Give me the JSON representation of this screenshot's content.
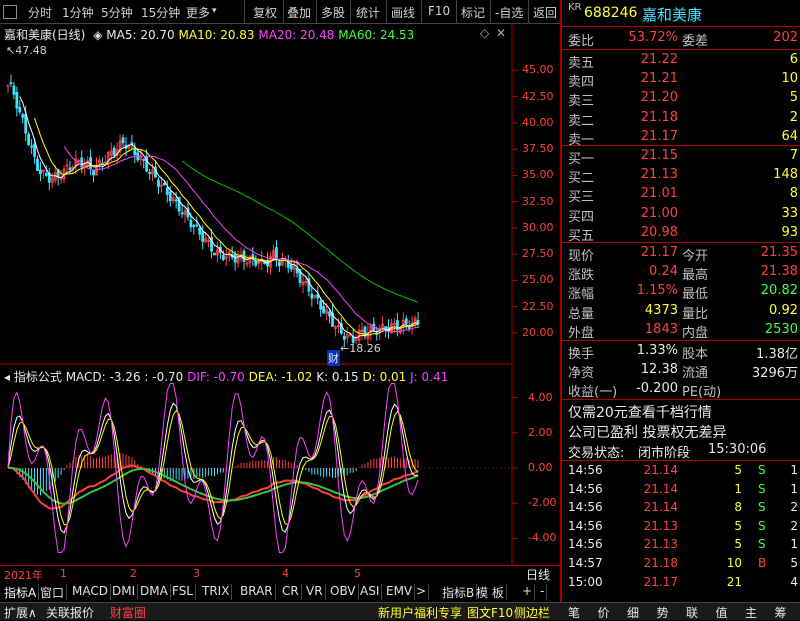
{
  "toolbar": {
    "items": [
      "分时",
      "1分钟",
      "5分钟",
      "15分钟",
      "更多",
      "复权",
      "叠加",
      "多股",
      "统计",
      "画线",
      "F10",
      "标记",
      "-自选",
      "返回"
    ]
  },
  "chart_header": {
    "name": "嘉和美康(日线)",
    "ma5": "MA5: 20.70",
    "ma10": "MA10: 20.83",
    "ma20": "MA20: 20.48",
    "ma60": "MA60: 24.53",
    "high_label": "47.48",
    "low_label": "18.26",
    "cai_label": "财"
  },
  "price_axis": [
    "45.00",
    "42.50",
    "40.00",
    "37.50",
    "35.00",
    "32.50",
    "30.00",
    "27.50",
    "25.00",
    "22.50",
    "20.00"
  ],
  "indicator_header": {
    "label": "指标公式",
    "macd": "MACD: -3.26 : -0.70",
    "dif": "DIF: -0.70",
    "dea": "DEA: -1.02",
    "k": "K: 0.15",
    "d": "D: 0.01",
    "j": "J: 0.41"
  },
  "indicator_axis": [
    "4.00",
    "2.00",
    "0.00",
    "-2.00",
    "-4.00"
  ],
  "date_axis": {
    "year": "2021年",
    "marks": [
      "1",
      "2",
      "3",
      "4",
      "5"
    ],
    "right": "日线"
  },
  "bottom_tabs": [
    "指标A",
    "窗口",
    "MACD",
    "DMI",
    "DMA",
    "FSL",
    "TRIX",
    "BRAR",
    "CR",
    "VR",
    "OBV",
    "ASI",
    "EMV",
    ">",
    "指标B",
    "模 板",
    "+",
    "-"
  ],
  "status_left": [
    "扩展∧",
    "关联报价",
    "财富圈"
  ],
  "status_right_text": [
    "新用户福利专享",
    "图文F10",
    "侧边栏"
  ],
  "status_buttons": [
    "笔",
    "价",
    "细",
    "势",
    "联",
    "值",
    "主",
    "筹"
  ],
  "quote": {
    "kr": "KR",
    "code": "688246",
    "name": "嘉和美康",
    "weibi_label": "委比",
    "weibi": "53.72%",
    "weicha_label": "委差",
    "weicha": "202",
    "asks": [
      {
        "label": "卖五",
        "price": "21.22",
        "vol": "6"
      },
      {
        "label": "卖四",
        "price": "21.21",
        "vol": "10"
      },
      {
        "label": "卖三",
        "price": "21.20",
        "vol": "5"
      },
      {
        "label": "卖二",
        "price": "21.18",
        "vol": "2"
      },
      {
        "label": "卖一",
        "price": "21.17",
        "vol": "64"
      }
    ],
    "bids": [
      {
        "label": "买一",
        "price": "21.15",
        "vol": "7"
      },
      {
        "label": "买二",
        "price": "21.13",
        "vol": "148"
      },
      {
        "label": "买三",
        "price": "21.01",
        "vol": "8"
      },
      {
        "label": "买四",
        "price": "21.00",
        "vol": "33"
      },
      {
        "label": "买五",
        "price": "20.98",
        "vol": "93"
      }
    ],
    "stats": [
      {
        "l1": "现价",
        "v1": "21.17",
        "l2": "今开",
        "v2": "21.35"
      },
      {
        "l1": "涨跌",
        "v1": "0.24",
        "l2": "最高",
        "v2": "21.38"
      },
      {
        "l1": "涨幅",
        "v1": "1.15%",
        "l2": "最低",
        "v2": "20.82"
      },
      {
        "l1": "总量",
        "v1": "4373",
        "l2": "量比",
        "v2": "0.92"
      },
      {
        "l1": "外盘",
        "v1": "1843",
        "l2": "内盘",
        "v2": "2530"
      }
    ],
    "stats2": [
      {
        "l1": "换手",
        "v1": "1.33%",
        "l2": "股本",
        "v2": "1.38亿"
      },
      {
        "l1": "净资",
        "v1": "12.38",
        "l2": "流通",
        "v2": "3296万"
      },
      {
        "l1": "收益(一)",
        "v1": "-0.200",
        "l2": "PE(动)",
        "v2": ""
      }
    ],
    "notice1": "仅需20元查看千档行情",
    "notice2": "公司已盈利 投票权无差异",
    "trade_state_label": "交易状态:",
    "trade_state": "闭市阶段",
    "trade_time": "15:30:06",
    "ticks": [
      {
        "time": "14:56",
        "price": "21.14",
        "vol": "5",
        "side": "S",
        "n": "1"
      },
      {
        "time": "14:56",
        "price": "21.14",
        "vol": "1",
        "side": "S",
        "n": "1"
      },
      {
        "time": "14:56",
        "price": "21.14",
        "vol": "8",
        "side": "S",
        "n": "2"
      },
      {
        "time": "14:56",
        "price": "21.13",
        "vol": "5",
        "side": "S",
        "n": "2"
      },
      {
        "time": "14:56",
        "price": "21.13",
        "vol": "5",
        "side": "S",
        "n": "1"
      },
      {
        "time": "14:57",
        "price": "21.18",
        "vol": "10",
        "side": "B",
        "n": "5"
      },
      {
        "time": "15:00",
        "price": "21.17",
        "vol": "21",
        "side": "",
        "n": "4"
      }
    ]
  },
  "colors": {
    "up": "#ff4040",
    "down": "#40ff40",
    "ma5": "#ffffff",
    "ma10": "#ffff00",
    "ma20": "#ff40ff",
    "ma60": "#00c000",
    "axis": "#a00000"
  }
}
